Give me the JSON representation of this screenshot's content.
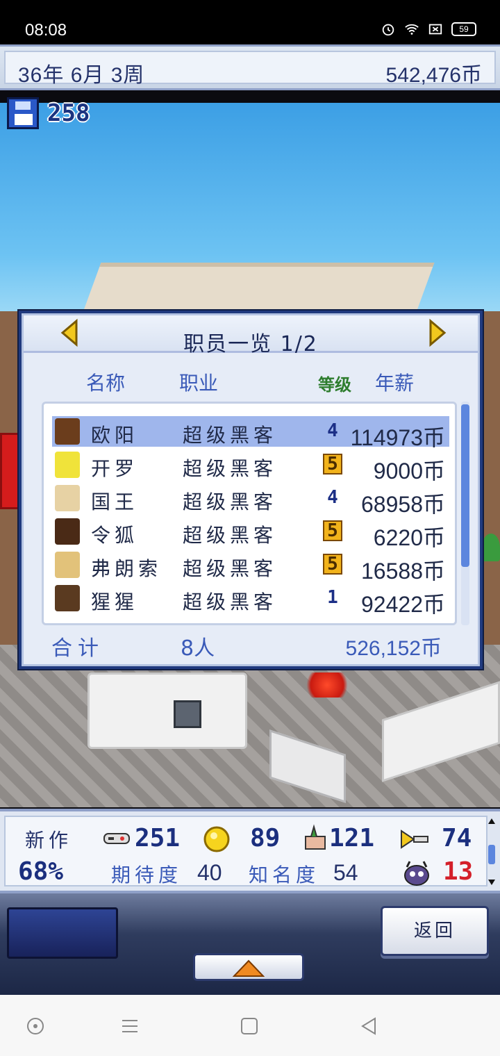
{
  "status_bar": {
    "time": "08:08",
    "battery": "59"
  },
  "top_bar": {
    "date": "36年 6月 3周",
    "money": "542,476币"
  },
  "save": {
    "count": "258"
  },
  "dialog": {
    "title": "职员一览 1/2",
    "headers": {
      "name": "名称",
      "job": "职业",
      "level": "等级",
      "salary": "年薪"
    },
    "rows": [
      {
        "name": "欧阳",
        "job": "超级黑客",
        "level": "4",
        "level_style": "blue",
        "salary": "114973币",
        "selected": true,
        "avatar_color": "#6b3d1c"
      },
      {
        "name": "开罗",
        "job": "超级黑客",
        "level": "5",
        "level_style": "gold",
        "salary": "9000币",
        "selected": false,
        "avatar_color": "#f0e33a"
      },
      {
        "name": "国王",
        "job": "超级黑客",
        "level": "4",
        "level_style": "blue",
        "salary": "68958币",
        "selected": false,
        "avatar_color": "#e7d2a4"
      },
      {
        "name": "令狐",
        "job": "超级黑客",
        "level": "5",
        "level_style": "gold",
        "salary": "6220币",
        "selected": false,
        "avatar_color": "#4a2a16"
      },
      {
        "name": "弗朗索",
        "job": "超级黑客",
        "level": "5",
        "level_style": "gold",
        "salary": "16588币",
        "selected": false,
        "avatar_color": "#e2c27a"
      },
      {
        "name": "猩猩",
        "job": "超级黑客",
        "level": "1",
        "level_style": "blue",
        "salary": "92422币",
        "selected": false,
        "avatar_color": "#5a3a20"
      }
    ],
    "total": {
      "label": "合计",
      "count": "8人",
      "sum": "526,152币"
    }
  },
  "stats": {
    "new_work_label": "新作",
    "progress": "68%",
    "controller_value": "251",
    "coin_value": "89",
    "fan_value": "121",
    "bug_value": "74",
    "expect_label": "期待度",
    "expect_value": "40",
    "fame_label": "知名度",
    "fame_value": "54",
    "monster_value": "13"
  },
  "controls": {
    "back_label": "返回"
  }
}
